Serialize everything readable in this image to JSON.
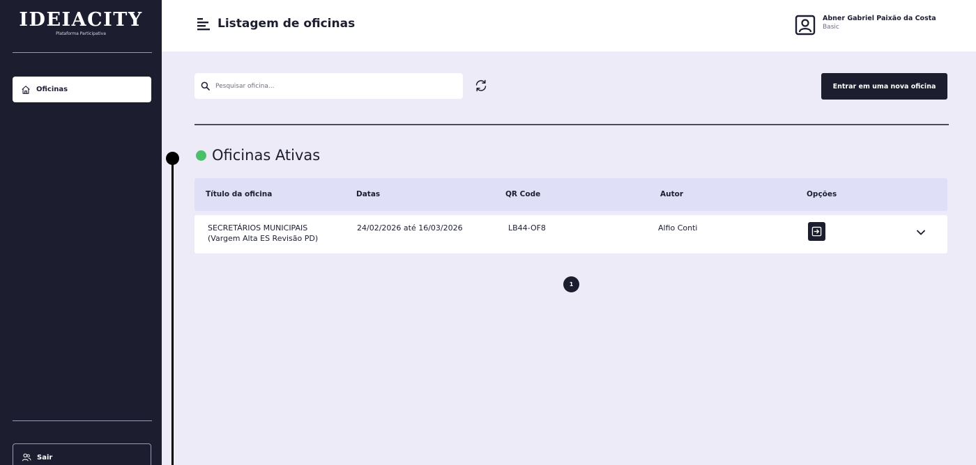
{
  "app": {
    "logo_title": "IDEIACITY",
    "logo_subtitle": "Plataforma Participativa"
  },
  "sidebar": {
    "items": [
      {
        "label": "Oficinas",
        "icon": "home-icon",
        "active": true
      }
    ],
    "logout_label": "Sair",
    "logout_icon": "users-icon"
  },
  "header": {
    "title": "Listagem de oficinas",
    "menu_icon": "menu-lines-icon",
    "user": {
      "name": "Abner Gabriel Paixão da Costa",
      "role": "Basic",
      "icon": "user-avatar-icon"
    }
  },
  "toolbar": {
    "search_placeholder": "Pesquisar oficina...",
    "search_value": "",
    "refresh_icon": "refresh-icon",
    "new_button_label": "Entrar em uma nova oficina"
  },
  "section": {
    "title": "Oficinas Ativas",
    "status_color": "#4bbf6b"
  },
  "table": {
    "columns": [
      "Título da oficina",
      "Datas",
      "QR Code",
      "Autor",
      "Opções"
    ],
    "rows": [
      {
        "title_line1": "SECRETÁRIOS MUNICIPAIS",
        "title_line2": "(Vargem Alta ES Revisão PD)",
        "dates": "24/02/2026 até 16/03/2026",
        "qr_code": "LB44-OF8",
        "author": "Alfio Conti",
        "option_icon": "enter-icon",
        "expand_icon": "chevron-down-icon"
      }
    ]
  },
  "pagination": {
    "current_page": "1"
  },
  "colors": {
    "sidebar_bg": "#1c1e30",
    "page_bg": "#ecebf7",
    "accent": "#1c1e30",
    "table_header_bg": "#dfe0f8",
    "status_active": "#4bbf6b"
  }
}
